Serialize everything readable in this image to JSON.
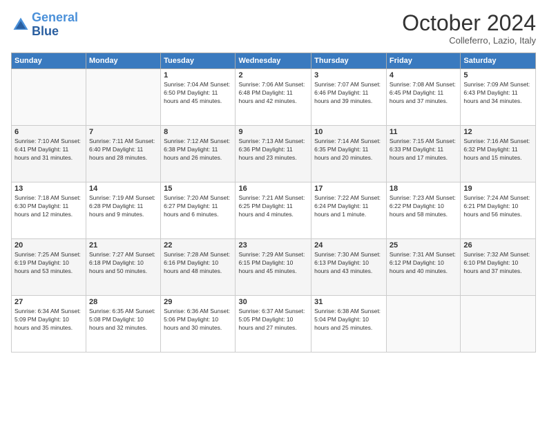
{
  "header": {
    "logo_line1": "General",
    "logo_line2": "Blue",
    "month": "October 2024",
    "location": "Colleferro, Lazio, Italy"
  },
  "weekdays": [
    "Sunday",
    "Monday",
    "Tuesday",
    "Wednesday",
    "Thursday",
    "Friday",
    "Saturday"
  ],
  "weeks": [
    [
      {
        "day": "",
        "info": ""
      },
      {
        "day": "",
        "info": ""
      },
      {
        "day": "1",
        "info": "Sunrise: 7:04 AM\nSunset: 6:50 PM\nDaylight: 11 hours and 45 minutes."
      },
      {
        "day": "2",
        "info": "Sunrise: 7:06 AM\nSunset: 6:48 PM\nDaylight: 11 hours and 42 minutes."
      },
      {
        "day": "3",
        "info": "Sunrise: 7:07 AM\nSunset: 6:46 PM\nDaylight: 11 hours and 39 minutes."
      },
      {
        "day": "4",
        "info": "Sunrise: 7:08 AM\nSunset: 6:45 PM\nDaylight: 11 hours and 37 minutes."
      },
      {
        "day": "5",
        "info": "Sunrise: 7:09 AM\nSunset: 6:43 PM\nDaylight: 11 hours and 34 minutes."
      }
    ],
    [
      {
        "day": "6",
        "info": "Sunrise: 7:10 AM\nSunset: 6:41 PM\nDaylight: 11 hours and 31 minutes."
      },
      {
        "day": "7",
        "info": "Sunrise: 7:11 AM\nSunset: 6:40 PM\nDaylight: 11 hours and 28 minutes."
      },
      {
        "day": "8",
        "info": "Sunrise: 7:12 AM\nSunset: 6:38 PM\nDaylight: 11 hours and 26 minutes."
      },
      {
        "day": "9",
        "info": "Sunrise: 7:13 AM\nSunset: 6:36 PM\nDaylight: 11 hours and 23 minutes."
      },
      {
        "day": "10",
        "info": "Sunrise: 7:14 AM\nSunset: 6:35 PM\nDaylight: 11 hours and 20 minutes."
      },
      {
        "day": "11",
        "info": "Sunrise: 7:15 AM\nSunset: 6:33 PM\nDaylight: 11 hours and 17 minutes."
      },
      {
        "day": "12",
        "info": "Sunrise: 7:16 AM\nSunset: 6:32 PM\nDaylight: 11 hours and 15 minutes."
      }
    ],
    [
      {
        "day": "13",
        "info": "Sunrise: 7:18 AM\nSunset: 6:30 PM\nDaylight: 11 hours and 12 minutes."
      },
      {
        "day": "14",
        "info": "Sunrise: 7:19 AM\nSunset: 6:28 PM\nDaylight: 11 hours and 9 minutes."
      },
      {
        "day": "15",
        "info": "Sunrise: 7:20 AM\nSunset: 6:27 PM\nDaylight: 11 hours and 6 minutes."
      },
      {
        "day": "16",
        "info": "Sunrise: 7:21 AM\nSunset: 6:25 PM\nDaylight: 11 hours and 4 minutes."
      },
      {
        "day": "17",
        "info": "Sunrise: 7:22 AM\nSunset: 6:24 PM\nDaylight: 11 hours and 1 minute."
      },
      {
        "day": "18",
        "info": "Sunrise: 7:23 AM\nSunset: 6:22 PM\nDaylight: 10 hours and 58 minutes."
      },
      {
        "day": "19",
        "info": "Sunrise: 7:24 AM\nSunset: 6:21 PM\nDaylight: 10 hours and 56 minutes."
      }
    ],
    [
      {
        "day": "20",
        "info": "Sunrise: 7:25 AM\nSunset: 6:19 PM\nDaylight: 10 hours and 53 minutes."
      },
      {
        "day": "21",
        "info": "Sunrise: 7:27 AM\nSunset: 6:18 PM\nDaylight: 10 hours and 50 minutes."
      },
      {
        "day": "22",
        "info": "Sunrise: 7:28 AM\nSunset: 6:16 PM\nDaylight: 10 hours and 48 minutes."
      },
      {
        "day": "23",
        "info": "Sunrise: 7:29 AM\nSunset: 6:15 PM\nDaylight: 10 hours and 45 minutes."
      },
      {
        "day": "24",
        "info": "Sunrise: 7:30 AM\nSunset: 6:13 PM\nDaylight: 10 hours and 43 minutes."
      },
      {
        "day": "25",
        "info": "Sunrise: 7:31 AM\nSunset: 6:12 PM\nDaylight: 10 hours and 40 minutes."
      },
      {
        "day": "26",
        "info": "Sunrise: 7:32 AM\nSunset: 6:10 PM\nDaylight: 10 hours and 37 minutes."
      }
    ],
    [
      {
        "day": "27",
        "info": "Sunrise: 6:34 AM\nSunset: 5:09 PM\nDaylight: 10 hours and 35 minutes."
      },
      {
        "day": "28",
        "info": "Sunrise: 6:35 AM\nSunset: 5:08 PM\nDaylight: 10 hours and 32 minutes."
      },
      {
        "day": "29",
        "info": "Sunrise: 6:36 AM\nSunset: 5:06 PM\nDaylight: 10 hours and 30 minutes."
      },
      {
        "day": "30",
        "info": "Sunrise: 6:37 AM\nSunset: 5:05 PM\nDaylight: 10 hours and 27 minutes."
      },
      {
        "day": "31",
        "info": "Sunrise: 6:38 AM\nSunset: 5:04 PM\nDaylight: 10 hours and 25 minutes."
      },
      {
        "day": "",
        "info": ""
      },
      {
        "day": "",
        "info": ""
      }
    ]
  ]
}
